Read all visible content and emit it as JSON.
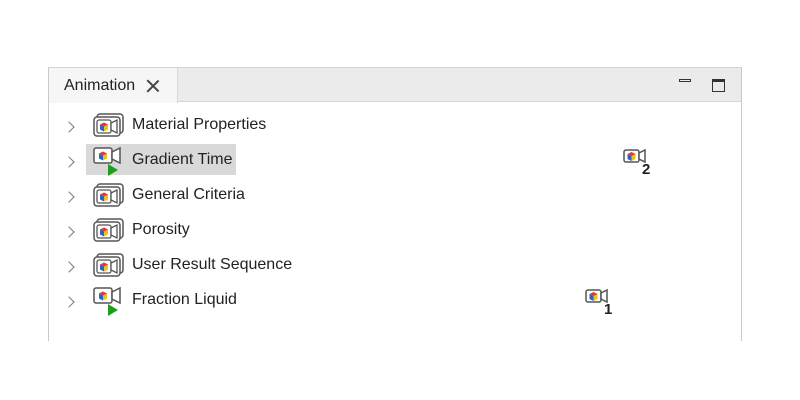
{
  "panel": {
    "tab_title": "Animation"
  },
  "tree": {
    "items": [
      {
        "label": "Material Properties",
        "icon": "video-folder-icon"
      },
      {
        "label": "Gradient Time",
        "icon": "camera-play-icon",
        "marker": "2"
      },
      {
        "label": "General Criteria",
        "icon": "video-folder-icon"
      },
      {
        "label": "Porosity",
        "icon": "video-folder-icon"
      },
      {
        "label": "User Result Sequence",
        "icon": "video-folder-icon"
      },
      {
        "label": "Fraction Liquid",
        "icon": "camera-play-icon",
        "marker": "1"
      }
    ]
  },
  "colors": {
    "selection": "#d9d9d9",
    "play_green": "#1e9e1e"
  }
}
